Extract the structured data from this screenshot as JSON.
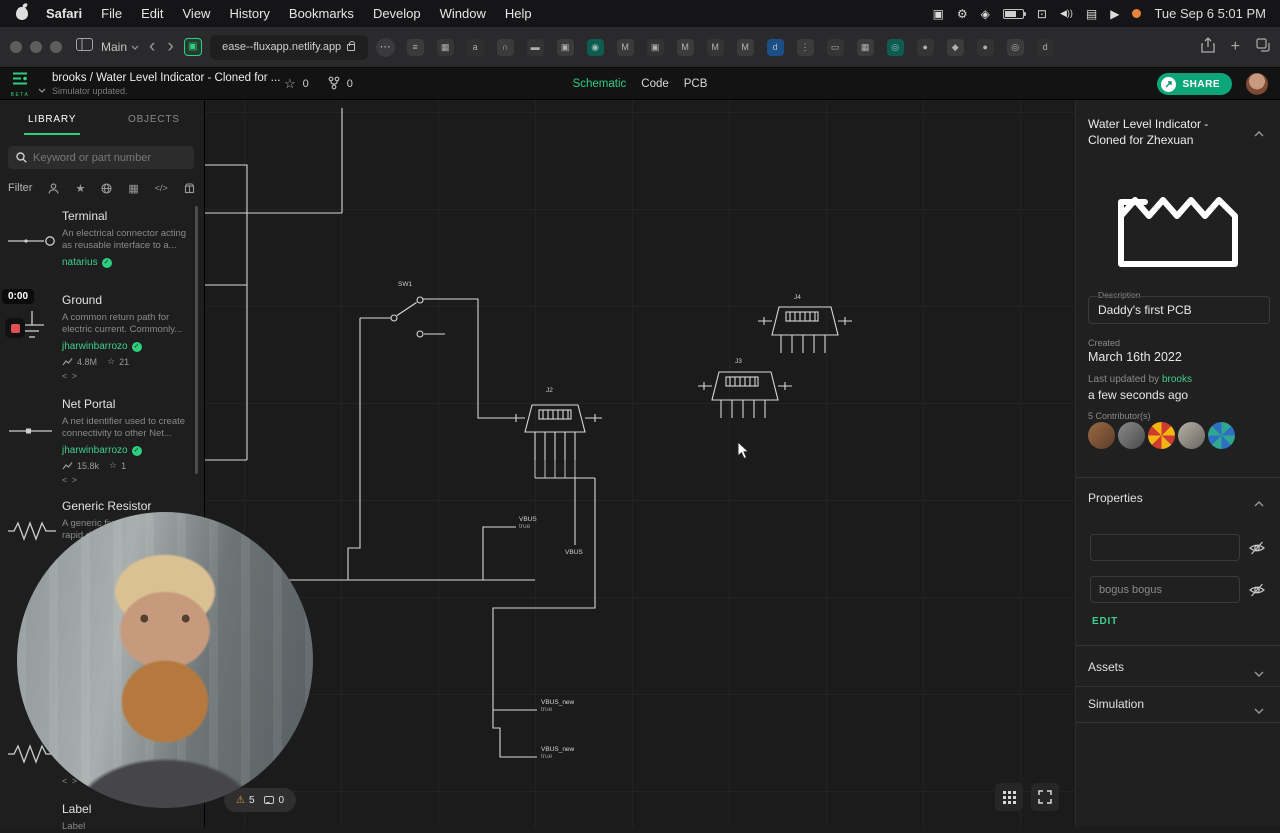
{
  "colors": {
    "accent_green": "#2ecf80",
    "share_teal": "#0ca678",
    "warning_orange": "#e2a33e",
    "record_red": "#e05252"
  },
  "menubar": {
    "items": [
      "Safari",
      "File",
      "Edit",
      "View",
      "History",
      "Bookmarks",
      "Develop",
      "Window",
      "Help"
    ],
    "clock": "Tue Sep 6 5:01 PM"
  },
  "browser": {
    "profile": "Main",
    "url": "ease--fluxapp.netlify.app",
    "favicons": [
      {
        "g": "≡",
        "bg": "#3b3b3b"
      },
      {
        "g": "▦",
        "bg": "#363636"
      },
      {
        "g": "a",
        "bg": "#2f2f2f"
      },
      {
        "g": "∩",
        "bg": "#3b3b3b"
      },
      {
        "g": "▬",
        "bg": "#333333"
      },
      {
        "g": "▣",
        "bg": "#3b3b3b"
      },
      {
        "g": "◉",
        "bg": "#0e5c50"
      },
      {
        "g": "M",
        "bg": "#3a3a3a"
      },
      {
        "g": "▣",
        "bg": "#333333"
      },
      {
        "g": "M",
        "bg": "#3b3b3b"
      },
      {
        "g": "M",
        "bg": "#343434"
      },
      {
        "g": "M",
        "bg": "#3b3b3b"
      },
      {
        "g": "d",
        "bg": "#1c4f86"
      },
      {
        "g": "⋮",
        "bg": "#3b3b3b"
      },
      {
        "g": "▭",
        "bg": "#343434"
      },
      {
        "g": "▦",
        "bg": "#3b3b3b"
      },
      {
        "g": "◎",
        "bg": "#0e5c50"
      },
      {
        "g": "●",
        "bg": "#343434"
      },
      {
        "g": "◆",
        "bg": "#3b3b3b"
      },
      {
        "g": "●",
        "bg": "#333333"
      },
      {
        "g": "◎",
        "bg": "#3b3b3b"
      },
      {
        "g": "d",
        "bg": "#2f2f2f"
      }
    ]
  },
  "header": {
    "beta": "BETA",
    "breadcrumb": "brooks / Water Level Indicator - Cloned for ...",
    "status": "Simulator updated.",
    "star_count": "0",
    "fork_count": "0",
    "tabs": [
      "Schematic",
      "Code",
      "PCB"
    ],
    "share_label": "SHARE"
  },
  "sidebar": {
    "tabs": [
      "LIBRARY",
      "OBJECTS"
    ],
    "search_placeholder": "Keyword or part number",
    "filter_label": "Filter",
    "code_glyph": "< >",
    "items": [
      {
        "name": "Terminal",
        "desc1": "An electrical connector acting",
        "desc2": "as reusable interface to a...",
        "author": "natarius"
      },
      {
        "name": "Ground",
        "desc1": "A common return path for",
        "desc2": "electric current. Commonly...",
        "author": "jharwinbarrozo",
        "uses": "4.8M",
        "stars": "21"
      },
      {
        "name": "Net Portal",
        "desc1": "A net identifier used to create",
        "desc2": "connectivity to other Net...",
        "author": "jharwinbarrozo",
        "uses": "15.8k",
        "stars": "1"
      },
      {
        "name": "Generic Resistor",
        "desc1": "A generic fixed...",
        "desc2": "rapid d..."
      },
      {
        "name": "",
        "desc1": "",
        "desc2": ""
      },
      {
        "name": "Label",
        "desc1": "Label",
        "desc2": ""
      }
    ]
  },
  "recorder": {
    "timer": "0:00"
  },
  "canvas": {
    "components": {
      "sw1": "SW1",
      "j2": "J2",
      "j3": "J3",
      "j4": "J4"
    },
    "nets": {
      "vbus1_name": "VBUS",
      "vbus1_value": "true",
      "vbus2_name": "VBUS",
      "vbus3_name": "VBUS_new",
      "vbus3_value": "true",
      "vbus4_name": "VBUS_new",
      "vbus4_value": "true"
    },
    "warning_count": "5",
    "comment_count": "0"
  },
  "inspector": {
    "title": "Water Level Indicator - Cloned for Zhexuan",
    "description_label": "Description",
    "description_value": "Daddy's first PCB",
    "created_label": "Created",
    "created_value": "March 16th 2022",
    "updated_prefix": "Last updated by",
    "updated_author": "brooks",
    "updated_time": "a few seconds ago",
    "contributors_label": "5 Contributor(s)",
    "contributors": [
      {
        "bg": "linear-gradient(135deg,#9a6a45,#5c3d28)"
      },
      {
        "bg": "linear-gradient(135deg,#8a8a8a,#4a4a4a)"
      },
      {
        "bg": "repeating-conic-gradient(#cf3b2e 0% 12.5%,#f2b613 12.5% 25%)"
      },
      {
        "bg": "linear-gradient(135deg,#b5b0a8,#6a665f)"
      },
      {
        "bg": "repeating-conic-gradient(#2fa88f 0% 12.5%,#2d6fc2 12.5% 25%)"
      }
    ],
    "properties_label": "Properties",
    "property_placeholder": "bogus bogus",
    "edit_label": "EDIT",
    "assets_label": "Assets",
    "simulation_label": "Simulation"
  }
}
